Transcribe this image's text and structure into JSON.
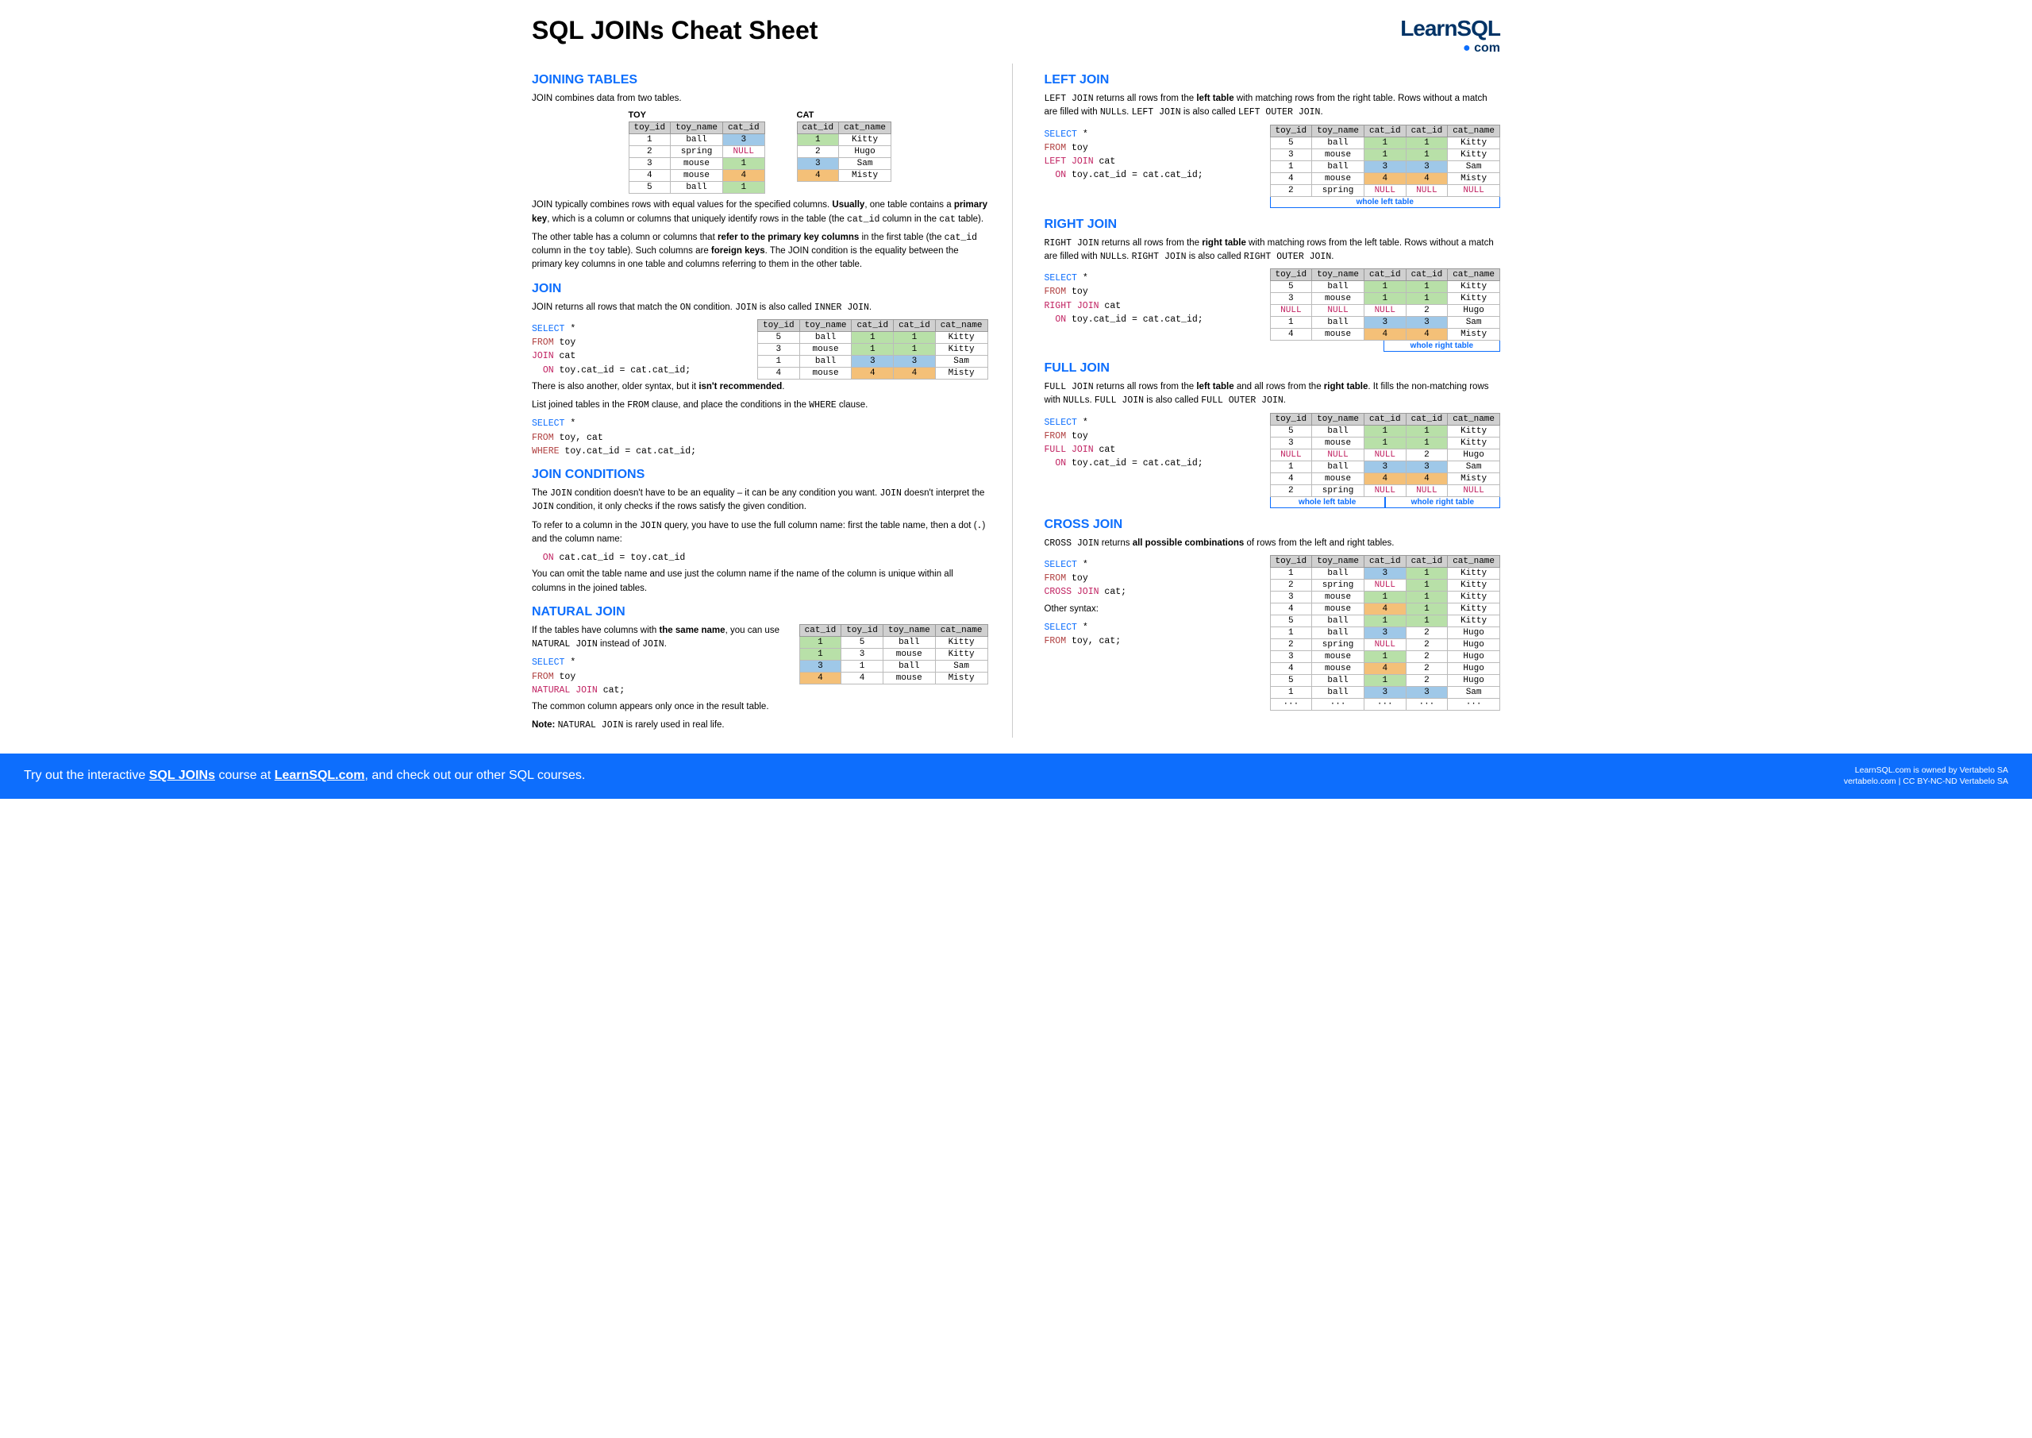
{
  "title": "SQL JOINs Cheat Sheet",
  "logo": {
    "top": "LearnSQL",
    "bot": "com"
  },
  "left": {
    "s1": {
      "h": "JOINING TABLES",
      "intro": "JOIN combines data from two tables.",
      "toyLabel": "TOY",
      "catLabel": "CAT",
      "toyHead": [
        "toy_id",
        "toy_name",
        "cat_id"
      ],
      "toyRows": [
        [
          "1",
          "ball",
          "3",
          "bg-b"
        ],
        [
          "2",
          "spring",
          "NULL",
          ""
        ],
        [
          "3",
          "mouse",
          "1",
          "bg-g"
        ],
        [
          "4",
          "mouse",
          "4",
          "bg-o"
        ],
        [
          "5",
          "ball",
          "1",
          "bg-g"
        ]
      ],
      "catHead": [
        "cat_id",
        "cat_name"
      ],
      "catRows": [
        [
          "1",
          "Kitty",
          "bg-g"
        ],
        [
          "2",
          "Hugo",
          ""
        ],
        [
          "3",
          "Sam",
          "bg-b"
        ],
        [
          "4",
          "Misty",
          "bg-o"
        ]
      ],
      "p1a": "JOIN typically combines rows with equal values for the specified columns. ",
      "p1b": "Usually",
      "p1c": ", one table contains a ",
      "p1d": "primary key",
      "p1e": ", which is a column or columns that uniquely identify rows in the table (the ",
      "p1f": "cat_id",
      "p1g": " column in the ",
      "p1h": "cat",
      "p1i": " table).",
      "p2a": "The other table has a column or columns that ",
      "p2b": "refer to the primary key columns",
      "p2c": " in the first table (the ",
      "p2d": "cat_id",
      "p2e": " column in the ",
      "p2f": "toy",
      "p2g": " table). Such columns are ",
      "p2h": "foreign keys",
      "p2i": ". The JOIN condition is the equality between the primary key columns in one table and columns referring to them in the other table."
    },
    "s2": {
      "h": "JOIN",
      "p1a": "JOIN returns all rows that match the ",
      "p1b": "ON",
      "p1c": " condition. ",
      "p1d": "JOIN",
      "p1e": " is also called ",
      "p1f": "INNER JOIN",
      "p1g": ".",
      "sql1": [
        "SELECT *",
        "FROM toy",
        "JOIN cat",
        "  ON toy.cat_id = cat.cat_id;"
      ],
      "resHead": [
        "toy_id",
        "toy_name",
        "cat_id",
        "cat_id",
        "cat_name"
      ],
      "resRows": [
        [
          "5",
          "ball",
          "1",
          "1",
          "Kitty",
          "bg-g",
          "bg-g"
        ],
        [
          "3",
          "mouse",
          "1",
          "1",
          "Kitty",
          "bg-g",
          "bg-g"
        ],
        [
          "1",
          "ball",
          "3",
          "3",
          "Sam",
          "bg-b",
          "bg-b"
        ],
        [
          "4",
          "mouse",
          "4",
          "4",
          "Misty",
          "bg-o",
          "bg-o"
        ]
      ],
      "p2a": "There is also another, older syntax, but it ",
      "p2b": "isn't recommended",
      "p2c": ".",
      "p3a": "List joined tables in the ",
      "p3b": "FROM",
      "p3c": " clause, and place the conditions in the ",
      "p3d": "WHERE",
      "p3e": " clause.",
      "sql2": [
        "SELECT *",
        "FROM toy, cat",
        "WHERE toy.cat_id = cat.cat_id;"
      ]
    },
    "s3": {
      "h": "JOIN CONDITIONS",
      "p1a": "The ",
      "p1b": "JOIN",
      "p1c": " condition doesn't have to be an equality – it can be any condition you want. ",
      "p1d": "JOIN",
      "p1e": " doesn't interpret the ",
      "p1f": "JOIN",
      "p1g": " condition, it only checks if the rows satisfy the given condition.",
      "p2a": "To refer to a column in the ",
      "p2b": "JOIN",
      "p2c": " query, you have to use the full column name: first the table name, then a dot (",
      "p2d": ".",
      "p2e": ") and the column name:",
      "sql": "  ON cat.cat_id = toy.cat_id",
      "p3": "You can omit the table name and use just the column name if the name of the column is unique within all columns in the joined tables."
    },
    "s4": {
      "h": "NATURAL JOIN",
      "p1a": "If the tables have columns with ",
      "p1b": "the same name",
      "p1c": ", you can use ",
      "p1d": "NATURAL JOIN",
      "p1e": " instead of ",
      "p1f": "JOIN",
      "p1g": ".",
      "sql": [
        "SELECT *",
        "FROM toy",
        "NATURAL JOIN cat;"
      ],
      "resHead": [
        "cat_id",
        "toy_id",
        "toy_name",
        "cat_name"
      ],
      "resRows": [
        [
          "1",
          "5",
          "ball",
          "Kitty",
          "bg-g"
        ],
        [
          "1",
          "3",
          "mouse",
          "Kitty",
          "bg-g"
        ],
        [
          "3",
          "1",
          "ball",
          "Sam",
          "bg-b"
        ],
        [
          "4",
          "4",
          "mouse",
          "Misty",
          "bg-o"
        ]
      ],
      "p2": "The common column appears only once in the result table.",
      "p3a": "Note: ",
      "p3b": "NATURAL JOIN",
      "p3c": " is rarely used in real life."
    }
  },
  "right": {
    "s1": {
      "h": "LEFT JOIN",
      "p1a": "LEFT JOIN",
      "p1b": " returns all rows from the ",
      "p1c": "left table",
      "p1d": " with matching rows from the right table. Rows without a match are filled with ",
      "p1e": "NULL",
      "p1f": "s. ",
      "p1g": "LEFT JOIN",
      "p1h": " is also called ",
      "p1i": "LEFT OUTER JOIN",
      "p1j": ".",
      "sql": [
        "SELECT *",
        "FROM toy",
        "LEFT JOIN cat",
        "  ON toy.cat_id = cat.cat_id;"
      ],
      "resHead": [
        "toy_id",
        "toy_name",
        "cat_id",
        "cat_id",
        "cat_name"
      ],
      "resRows": [
        [
          "5",
          "ball",
          "1",
          "1",
          "Kitty",
          "bg-g",
          "bg-g"
        ],
        [
          "3",
          "mouse",
          "1",
          "1",
          "Kitty",
          "bg-g",
          "bg-g"
        ],
        [
          "1",
          "ball",
          "3",
          "3",
          "Sam",
          "bg-b",
          "bg-b"
        ],
        [
          "4",
          "mouse",
          "4",
          "4",
          "Misty",
          "bg-o",
          "bg-o"
        ],
        [
          "2",
          "spring",
          "NULL",
          "NULL",
          "NULL",
          "",
          ""
        ]
      ],
      "cap": "whole left table"
    },
    "s2": {
      "h": "RIGHT JOIN",
      "p1a": "RIGHT JOIN",
      "p1b": " returns all rows from the ",
      "p1c": "right table",
      "p1d": " with matching rows from the left table. Rows without a match are filled with ",
      "p1e": "NULL",
      "p1f": "s. ",
      "p1g": "RIGHT JOIN",
      "p1h": " is also called ",
      "p1i": "RIGHT OUTER JOIN",
      "p1j": ".",
      "sql": [
        "SELECT *",
        "FROM toy",
        "RIGHT JOIN cat",
        "  ON toy.cat_id = cat.cat_id;"
      ],
      "resHead": [
        "toy_id",
        "toy_name",
        "cat_id",
        "cat_id",
        "cat_name"
      ],
      "resRows": [
        [
          "5",
          "ball",
          "1",
          "1",
          "Kitty",
          "bg-g",
          "bg-g"
        ],
        [
          "3",
          "mouse",
          "1",
          "1",
          "Kitty",
          "bg-g",
          "bg-g"
        ],
        [
          "NULL",
          "NULL",
          "NULL",
          "2",
          "Hugo",
          "",
          ""
        ],
        [
          "1",
          "ball",
          "3",
          "3",
          "Sam",
          "bg-b",
          "bg-b"
        ],
        [
          "4",
          "mouse",
          "4",
          "4",
          "Misty",
          "bg-o",
          "bg-o"
        ]
      ],
      "cap": "whole right table"
    },
    "s3": {
      "h": "FULL JOIN",
      "p1a": "FULL JOIN",
      "p1b": " returns all rows from the ",
      "p1c": "left table",
      "p1d": " and all rows from the ",
      "p1e": "right table",
      "p1f": ". It fills the non-matching rows with ",
      "p1g": "NULL",
      "p1h": "s. ",
      "p1i": "FULL JOIN",
      "p1j": " is also called ",
      "p1k": "FULL OUTER JOIN",
      "p1l": ".",
      "sql": [
        "SELECT *",
        "FROM toy",
        "FULL JOIN cat",
        "  ON toy.cat_id = cat.cat_id;"
      ],
      "resHead": [
        "toy_id",
        "toy_name",
        "cat_id",
        "cat_id",
        "cat_name"
      ],
      "resRows": [
        [
          "5",
          "ball",
          "1",
          "1",
          "Kitty",
          "bg-g",
          "bg-g"
        ],
        [
          "3",
          "mouse",
          "1",
          "1",
          "Kitty",
          "bg-g",
          "bg-g"
        ],
        [
          "NULL",
          "NULL",
          "NULL",
          "2",
          "Hugo",
          "",
          ""
        ],
        [
          "1",
          "ball",
          "3",
          "3",
          "Sam",
          "bg-b",
          "bg-b"
        ],
        [
          "4",
          "mouse",
          "4",
          "4",
          "Misty",
          "bg-o",
          "bg-o"
        ],
        [
          "2",
          "spring",
          "NULL",
          "NULL",
          "NULL",
          "",
          ""
        ]
      ],
      "capL": "whole left table",
      "capR": "whole right table"
    },
    "s4": {
      "h": "CROSS JOIN",
      "p1a": "CROSS JOIN",
      "p1b": " returns ",
      "p1c": "all possible combinations",
      "p1d": " of rows from the left and right tables.",
      "sql1": [
        "SELECT *",
        "FROM toy",
        "CROSS JOIN cat;"
      ],
      "other": "Other syntax:",
      "sql2": [
        "SELECT *",
        "FROM toy, cat;"
      ],
      "resHead": [
        "toy_id",
        "toy_name",
        "cat_id",
        "cat_id",
        "cat_name"
      ],
      "resRows": [
        [
          "1",
          "ball",
          "3",
          "1",
          "Kitty",
          "bg-b",
          "bg-g"
        ],
        [
          "2",
          "spring",
          "NULL",
          "1",
          "Kitty",
          "",
          "bg-g"
        ],
        [
          "3",
          "mouse",
          "1",
          "1",
          "Kitty",
          "bg-g",
          "bg-g"
        ],
        [
          "4",
          "mouse",
          "4",
          "1",
          "Kitty",
          "bg-o",
          "bg-g"
        ],
        [
          "5",
          "ball",
          "1",
          "1",
          "Kitty",
          "bg-g",
          "bg-g"
        ],
        [
          "1",
          "ball",
          "3",
          "2",
          "Hugo",
          "bg-b",
          ""
        ],
        [
          "2",
          "spring",
          "NULL",
          "2",
          "Hugo",
          "",
          ""
        ],
        [
          "3",
          "mouse",
          "1",
          "2",
          "Hugo",
          "bg-g",
          ""
        ],
        [
          "4",
          "mouse",
          "4",
          "2",
          "Hugo",
          "bg-o",
          ""
        ],
        [
          "5",
          "ball",
          "1",
          "2",
          "Hugo",
          "bg-g",
          ""
        ],
        [
          "1",
          "ball",
          "3",
          "3",
          "Sam",
          "bg-b",
          "bg-b"
        ],
        [
          "···",
          "···",
          "···",
          "···",
          "···",
          "",
          ""
        ]
      ]
    }
  },
  "footer": {
    "l1": "Try out the interactive ",
    "l2": "SQL JOINs",
    "l3": " course at ",
    "l4": "LearnSQL.com",
    "l5": ", and check out our other SQL courses.",
    "r1": "LearnSQL.com is owned by Vertabelo SA",
    "r2": "vertabelo.com | CC BY-NC-ND Vertabelo SA"
  }
}
